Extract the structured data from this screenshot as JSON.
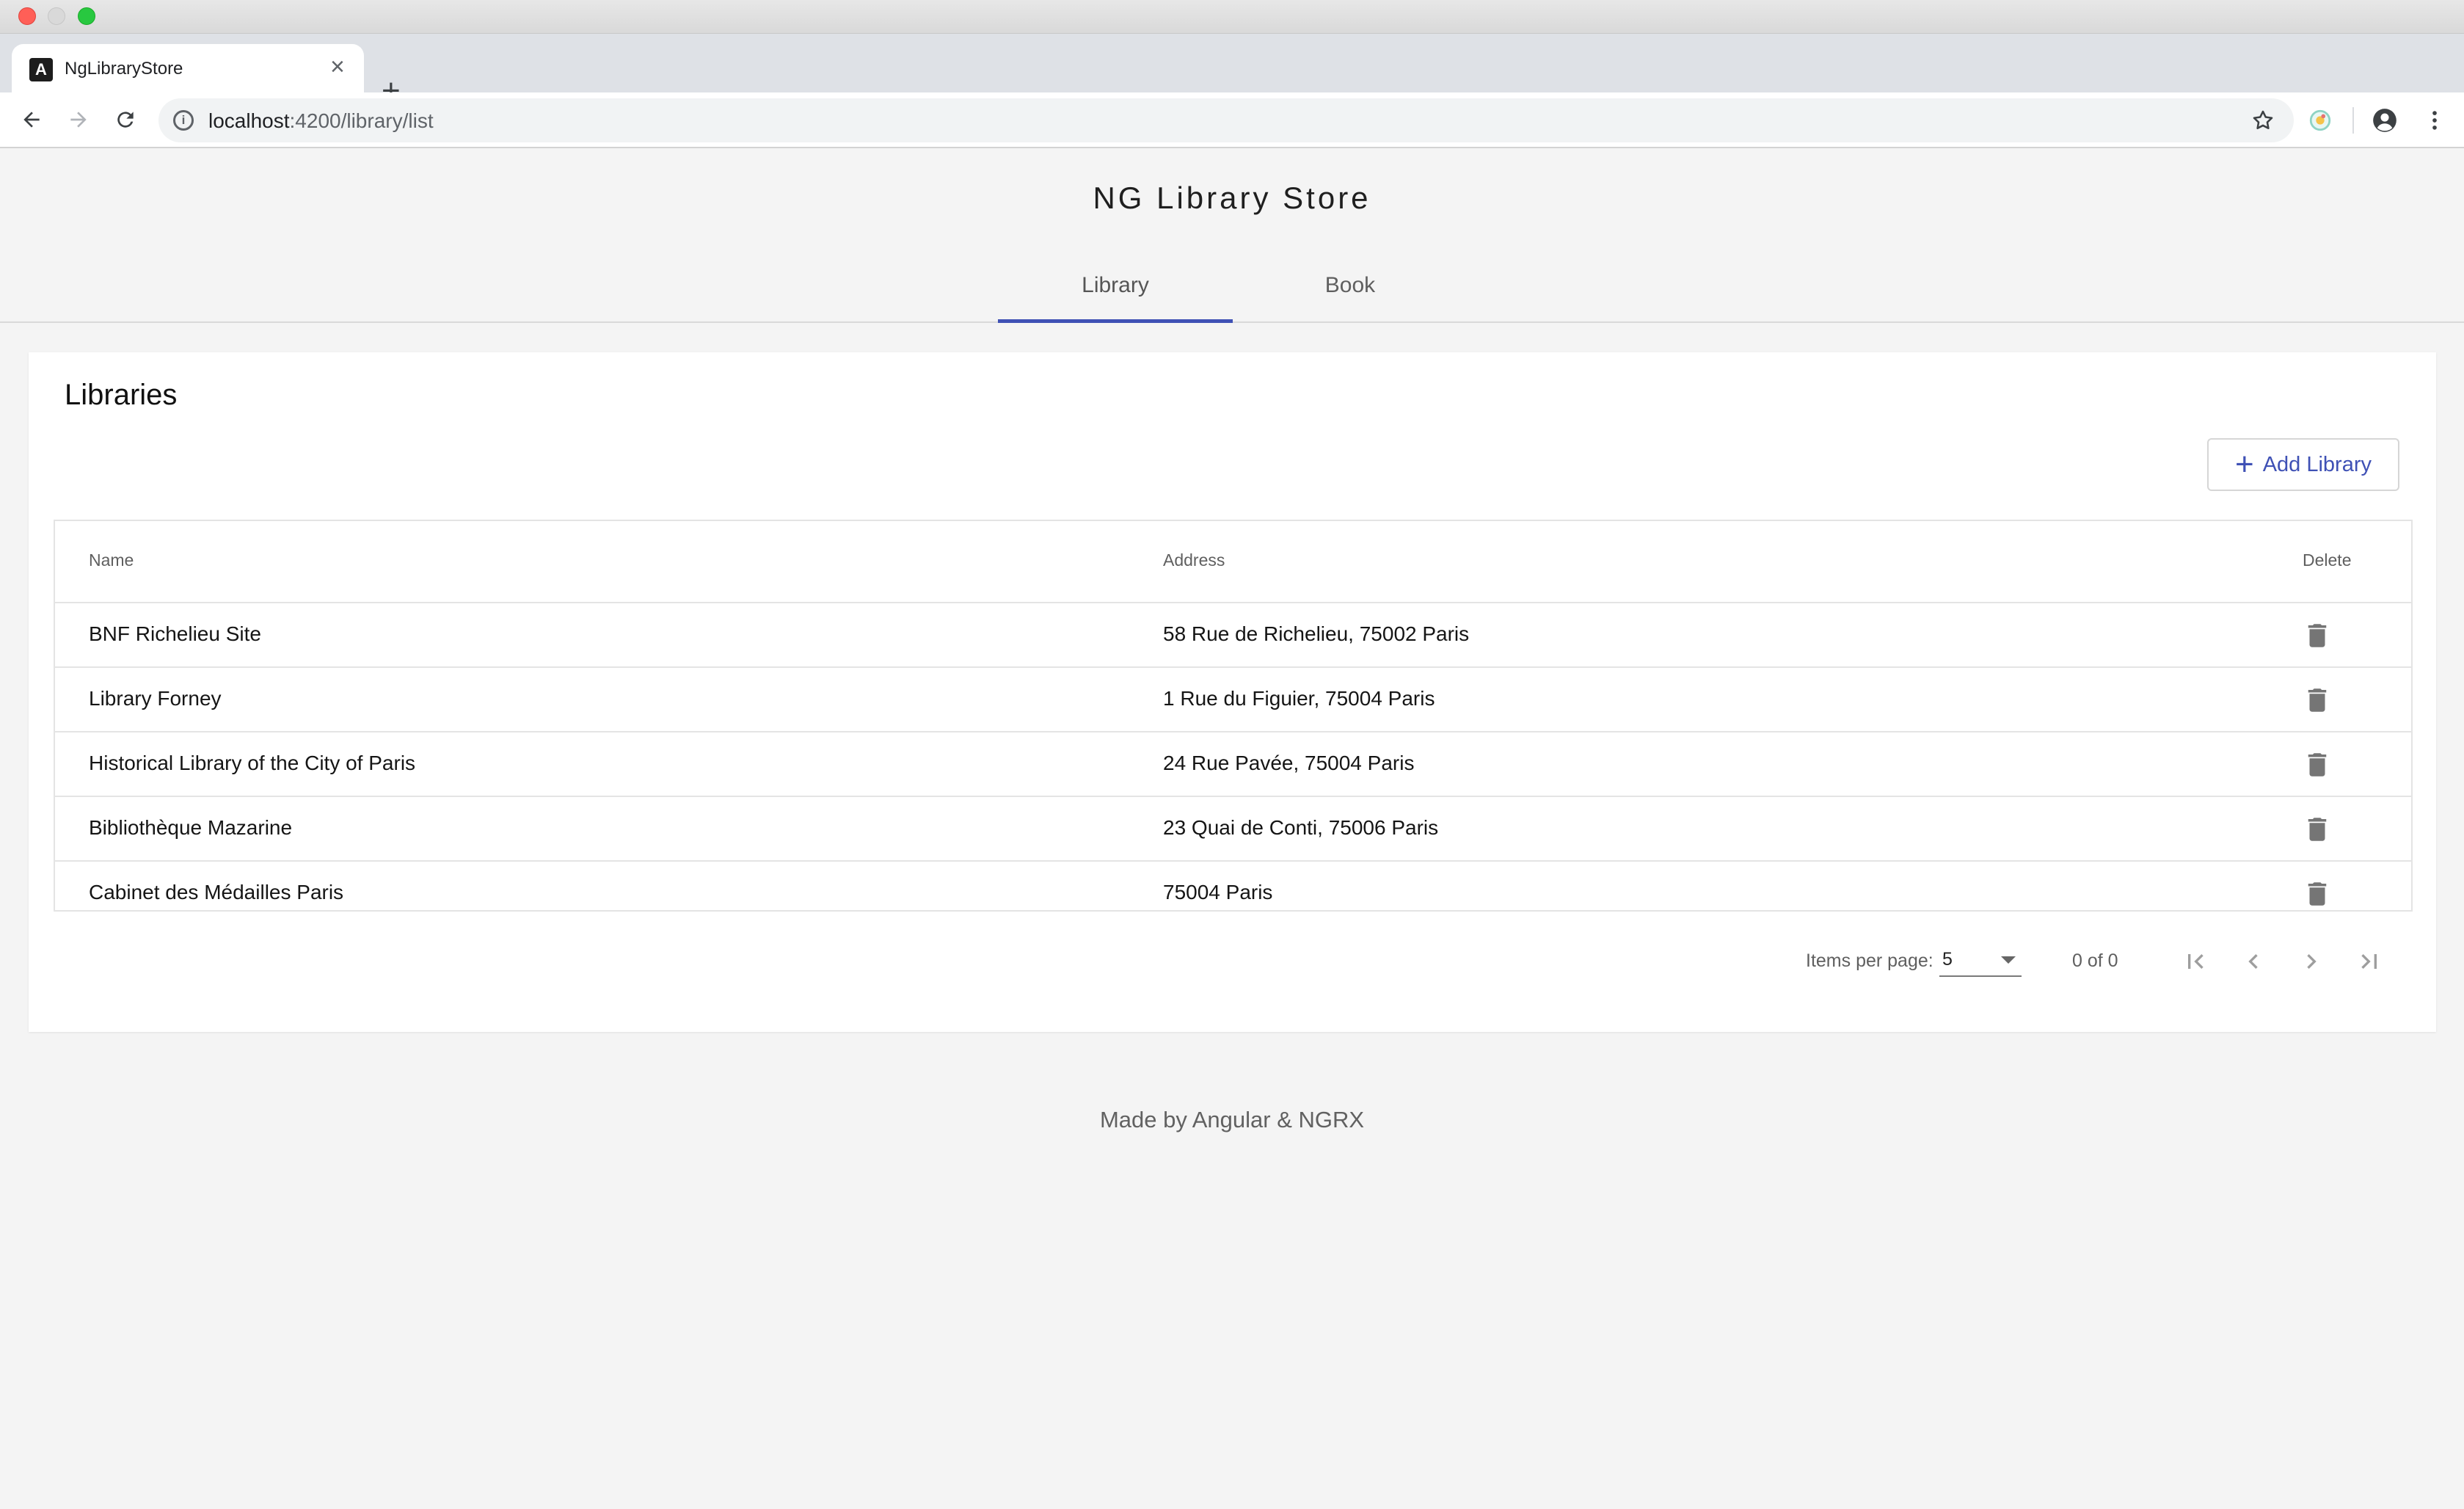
{
  "browser": {
    "tab_title": "NgLibraryStore",
    "favicon_letter": "A",
    "url_host": "localhost",
    "url_path": ":4200/library/list"
  },
  "app": {
    "title": "NG Library Store",
    "tabs": [
      {
        "label": "Library",
        "active": true
      },
      {
        "label": "Book",
        "active": false
      }
    ],
    "accent_color": "#3f51b5"
  },
  "libraries": {
    "heading": "Libraries",
    "add_button_label": "Add Library",
    "columns": {
      "name": "Name",
      "address": "Address",
      "delete": "Delete"
    },
    "rows": [
      {
        "name": "BNF Richelieu Site",
        "address": "58 Rue de Richelieu, 75002 Paris"
      },
      {
        "name": "Library Forney",
        "address": "1 Rue du Figuier, 75004 Paris"
      },
      {
        "name": "Historical Library of the City of Paris",
        "address": "24 Rue Pavée, 75004 Paris"
      },
      {
        "name": "Bibliothèque Mazarine",
        "address": "23 Quai de Conti, 75006 Paris"
      },
      {
        "name": "Cabinet des Médailles Paris",
        "address": "75004 Paris"
      }
    ],
    "paginator": {
      "items_per_page_label": "Items per page:",
      "page_size": "5",
      "range_label": "0 of 0"
    }
  },
  "footer": {
    "text": "Made by Angular & NGRX"
  }
}
